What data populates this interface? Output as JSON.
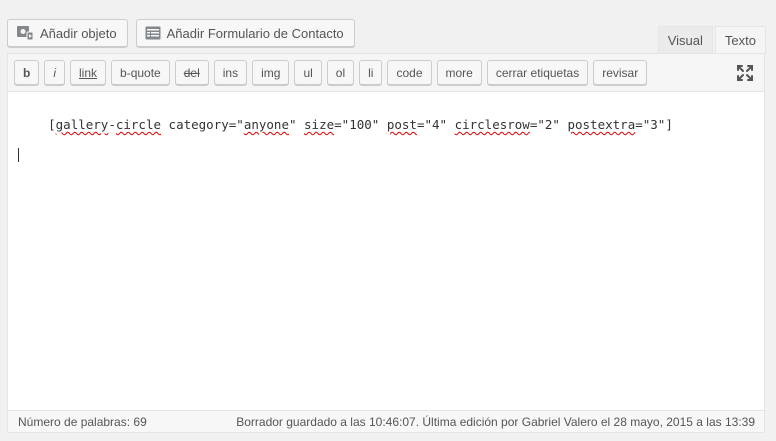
{
  "media_buttons": {
    "add_media": {
      "label": "Añadir objeto",
      "icon": "media-icon"
    },
    "add_form": {
      "label": "Añadir Formulario de Contacto",
      "icon": "form-icon"
    }
  },
  "tabs": [
    {
      "label": "Visual",
      "active": false
    },
    {
      "label": "Texto",
      "active": true
    }
  ],
  "quicktags": [
    "b",
    "i",
    "link",
    "b-quote",
    "del",
    "ins",
    "img",
    "ul",
    "ol",
    "li",
    "code",
    "more",
    "cerrar etiquetas",
    "revisar"
  ],
  "fullscreen_icon": "fullscreen-icon",
  "content": {
    "parts": [
      {
        "text": "[",
        "spell": false
      },
      {
        "text": "gallery",
        "spell": true
      },
      {
        "text": "-",
        "spell": false
      },
      {
        "text": "circle",
        "spell": true
      },
      {
        "text": " category=\"",
        "spell": false
      },
      {
        "text": "anyone",
        "spell": true
      },
      {
        "text": "\" ",
        "spell": false
      },
      {
        "text": "size",
        "spell": true
      },
      {
        "text": "=\"100\" ",
        "spell": false
      },
      {
        "text": "post",
        "spell": true
      },
      {
        "text": "=\"4\" ",
        "spell": false
      },
      {
        "text": "circlesrow",
        "spell": true
      },
      {
        "text": "=\"2\" ",
        "spell": false
      },
      {
        "text": "postextra",
        "spell": true
      },
      {
        "text": "=\"3\"]",
        "spell": false
      }
    ]
  },
  "status": {
    "word_count": "Número de palabras: 69",
    "draft_info": "Borrador guardado a las 10:46:07. Última edición por Gabriel Valero el 28 mayo, 2015 a las 13:39"
  }
}
